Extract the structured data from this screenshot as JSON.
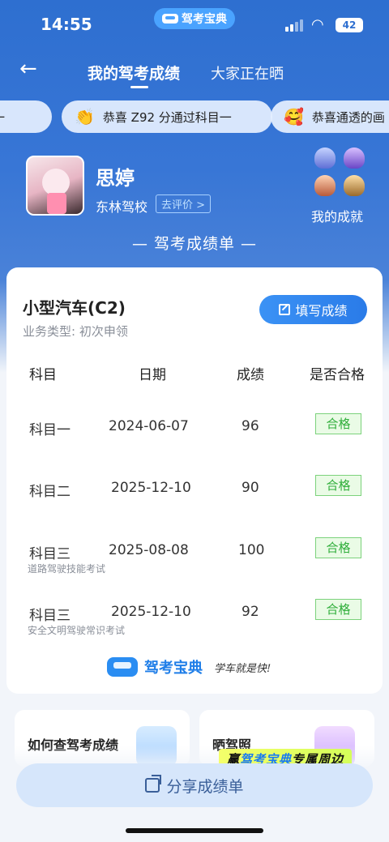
{
  "status": {
    "time": "14:55",
    "app_pill": "驾考宝典",
    "battery": "42"
  },
  "nav": {
    "back_icon": "arrow-left-icon",
    "tab_active": "我的驾考成绩",
    "tab_other": "大家正在晒"
  },
  "ticker": [
    {
      "emoji": "",
      "text": "目一"
    },
    {
      "emoji": "👏",
      "text": "恭喜 Z92 分通过科目一"
    },
    {
      "emoji": "🥰",
      "text": "恭喜通透的画"
    }
  ],
  "profile": {
    "name": "思婷",
    "school": "东林驾校",
    "rate_label": "去评价 >",
    "achievements_label": "我的成就"
  },
  "sheet_title": "— 驾考成绩单 —",
  "card": {
    "vehicle": "小型汽车(C2)",
    "business_type": "业务类型:  初次申领",
    "fill_button": "填写成绩",
    "headers": [
      "科目",
      "日期",
      "成绩",
      "是否合格"
    ],
    "rows": [
      {
        "subject": "科目一",
        "date": "2024-06-07",
        "score": "96",
        "result": "合格",
        "note": ""
      },
      {
        "subject": "科目二",
        "date": "2025-12-10",
        "score": "90",
        "result": "合格",
        "note": ""
      },
      {
        "subject": "科目三",
        "date": "2025-08-08",
        "score": "100",
        "result": "合格",
        "note": "道路驾驶技能考试"
      },
      {
        "subject": "科目三",
        "date": "2025-12-10",
        "score": "92",
        "result": "合格",
        "note": "安全文明驾驶常识考试"
      }
    ],
    "brand": "驾考宝典",
    "slogan": "学车就是快!"
  },
  "tiles": {
    "left_title": "如何查驾考成绩",
    "right_title": "晒驾照"
  },
  "promo": {
    "part1": "赢",
    "highlight": "驾考宝典",
    "part2": "专属周边"
  },
  "share_button": "分享成绩单",
  "colors": {
    "primary": "#2e6fd0",
    "accent": "#2a7be8",
    "pass_green": "#2fae3a"
  }
}
